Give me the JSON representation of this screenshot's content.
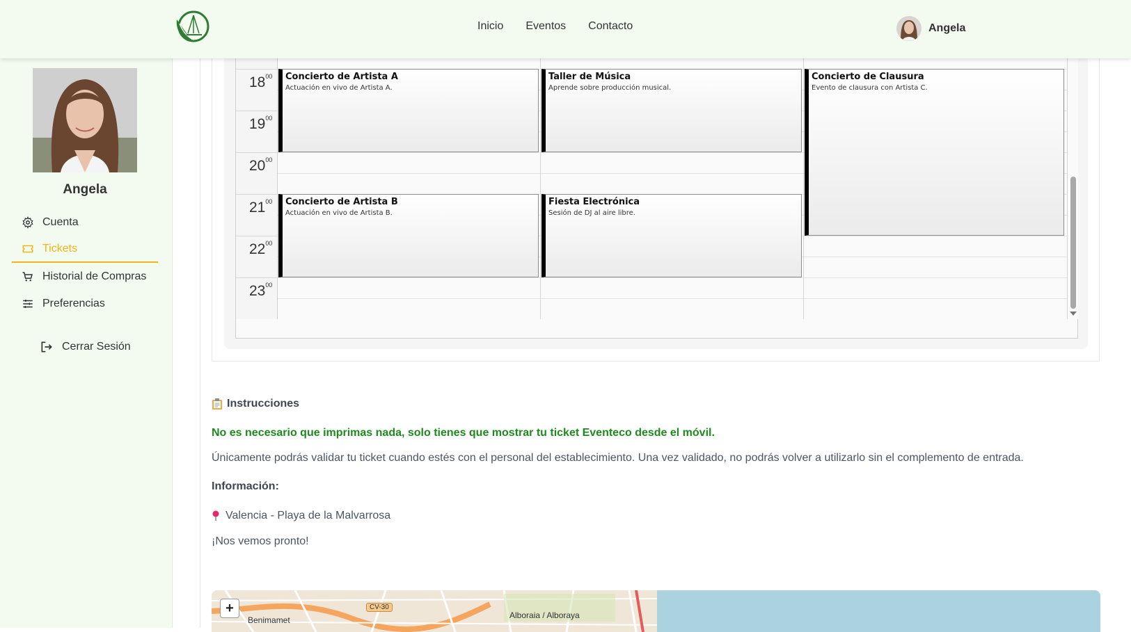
{
  "header": {
    "nav": [
      "Inicio",
      "Eventos",
      "Contacto"
    ],
    "user_name": "Angela"
  },
  "sidebar": {
    "profile_name": "Angela",
    "items": [
      {
        "label": "Cuenta",
        "icon": "gear-icon"
      },
      {
        "label": "Tickets",
        "icon": "ticket-icon",
        "active": true
      },
      {
        "label": "Historial de Compras",
        "icon": "cart-icon"
      },
      {
        "label": "Preferencias",
        "icon": "sliders-icon"
      }
    ],
    "logout": "Cerrar Sesión"
  },
  "calendar": {
    "hours": [
      "18",
      "19",
      "20",
      "21",
      "22",
      "23"
    ],
    "minutes": "00",
    "events": [
      {
        "title": "Concierto de Artista A",
        "desc": "Actuación en vivo de Artista A."
      },
      {
        "title": "Taller de Música",
        "desc": "Aprende sobre producción musical."
      },
      {
        "title": "Concierto de Clausura",
        "desc": "Evento de clausura con Artista C."
      },
      {
        "title": "Concierto de Artista B",
        "desc": "Actuación en vivo de Artista B."
      },
      {
        "title": "Fiesta Electrónica",
        "desc": "Sesión de DJ al aire libre."
      }
    ]
  },
  "instructions": {
    "title": "Instrucciones",
    "strong": "No es necesario que imprimas nada, solo tienes que mostrar tu ticket Eventeco desde el móvil.",
    "text": "Únicamente podrás validar tu ticket cuando estés con el personal del establecimiento. Una vez validado, no podrás volver a utilizarlo sin el complemento de entrada.",
    "info_label": "Información:",
    "location": "Valencia - Playa de la Malvarrosa",
    "see_you": "¡Nos vemos pronto!"
  },
  "map": {
    "zoom_in": "+",
    "labels": [
      "Benimamet",
      "Alboraia / Alboraya"
    ],
    "road": "CV-30"
  },
  "colors": {
    "accent": "#f2b318",
    "success": "#1e8a1e",
    "header_bg": "#f3fbf1"
  }
}
